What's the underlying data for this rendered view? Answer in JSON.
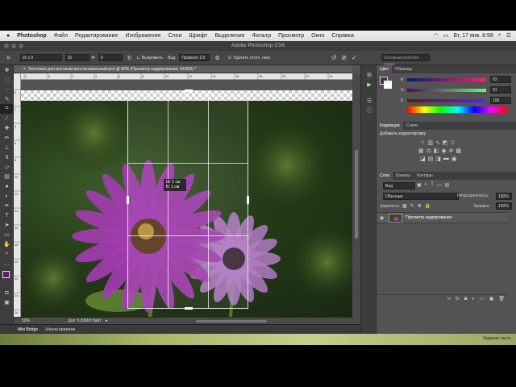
{
  "menubar": {
    "app": "Photoshop",
    "items": [
      "Файл",
      "Редактирование",
      "Изображение",
      "Слои",
      "Шрифт",
      "Выделение",
      "Фильтр",
      "Просмотр",
      "Окно",
      "Справка"
    ],
    "datetime": "Вт, 17 янв. 8:58"
  },
  "window": {
    "title": "Adobe Photoshop CS6"
  },
  "options": {
    "ratio": "16 x 9",
    "w": "16",
    "h": "9",
    "straighten": "Выпрямить",
    "view_label": "Вид:",
    "view": "Правило 1/3",
    "delete_cropped": "Удалить отсеч. пикс.",
    "workspace": "Основная рабочая среда"
  },
  "document": {
    "tab": "Заготовка для инстагам-восстановленный.psd @ 50% (Просмотр кадрирования, RGB/8) *",
    "zoom": "50%",
    "doc_info": "Док: 5,93М/0 байт",
    "crop_tooltip_w": "Ш: 1 см",
    "crop_tooltip_h": "В: 1 см",
    "ruler_h": [
      "2",
      "0",
      "2",
      "4",
      "6",
      "8",
      "10",
      "12",
      "14",
      "16",
      "18",
      "20",
      "22",
      "24"
    ],
    "ruler_v": [
      "0",
      "2",
      "4",
      "6",
      "8",
      "10",
      "12",
      "14",
      "16",
      "18",
      "20",
      "22",
      "24",
      "26"
    ]
  },
  "bottom": {
    "minibridge": "Mini Bridge",
    "timeline": "Шкала времени"
  },
  "color_panel": {
    "tabs": [
      "Цвет",
      "Образцы"
    ],
    "r": "93",
    "g": "31",
    "b": "106"
  },
  "adjustments": {
    "tabs": [
      "Коррекция",
      "Стили"
    ],
    "add": "Добавить корректировку"
  },
  "layers": {
    "tabs": [
      "Слои",
      "Каналы",
      "Контуры"
    ],
    "kind": "Вид",
    "blend": "Обычные",
    "opacity_label": "Непрозрачность:",
    "opacity": "100%",
    "lock_label": "Закрепить:",
    "fill_label": "Заливка:",
    "fill": "100%",
    "layer_name": "Просмотр кадрирования"
  },
  "dock": {
    "status": "Задание: пусто"
  },
  "colors": {
    "accent": "#5d1f6a",
    "petal": "#a23cb0",
    "foreground": "#5d1f6a"
  }
}
